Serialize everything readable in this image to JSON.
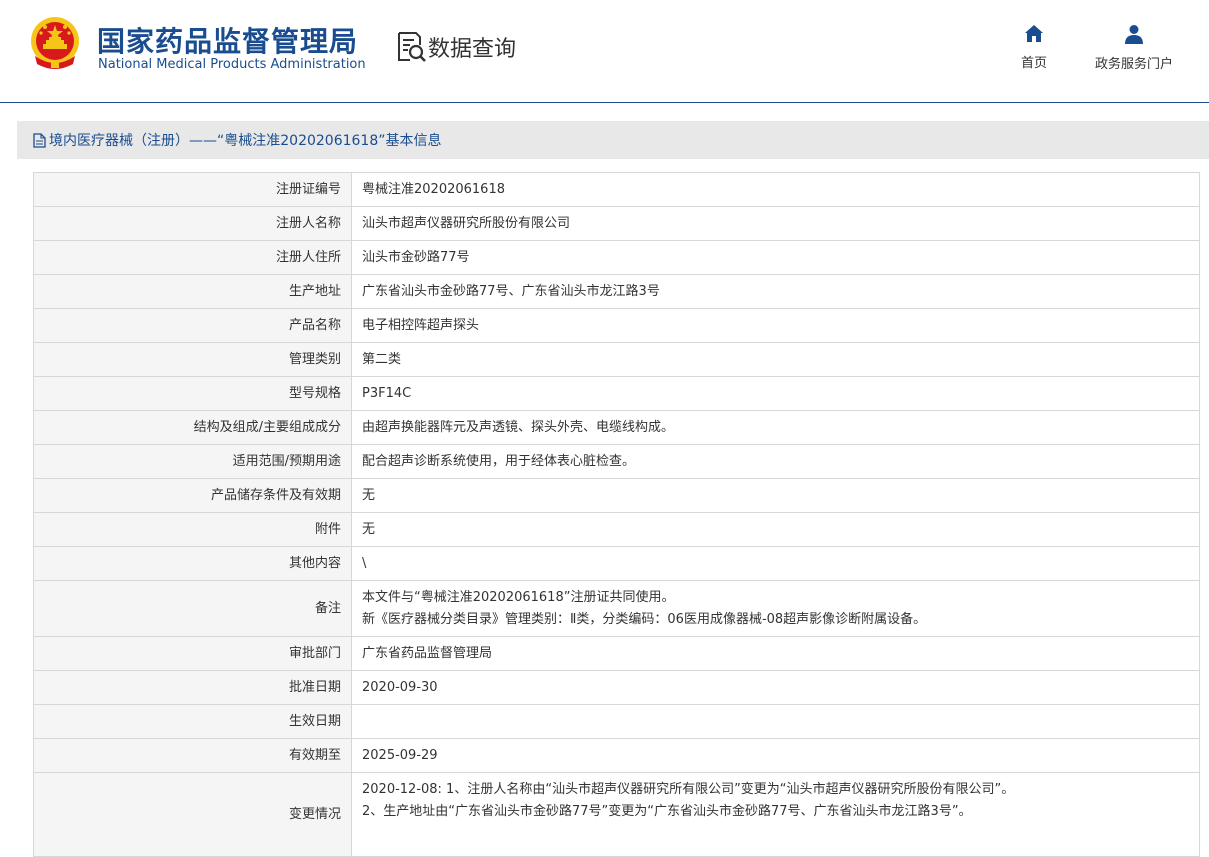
{
  "header": {
    "org_name_cn": "国家药品监督管理局",
    "org_name_en": "National Medical Products Administration",
    "query_label": "数据查询",
    "nav": [
      {
        "label": "首页",
        "icon": "home-icon"
      },
      {
        "label": "政务服务门户",
        "icon": "user-icon"
      }
    ]
  },
  "panel": {
    "title": "境内医疗器械（注册）——“粤械注准20202061618”基本信息",
    "title_icon": "document-icon"
  },
  "records": [
    {
      "label": "注册证编号",
      "value": "粤械注准20202061618"
    },
    {
      "label": "注册人名称",
      "value": "汕头市超声仪器研究所股份有限公司"
    },
    {
      "label": "注册人住所",
      "value": "汕头市金砂路77号"
    },
    {
      "label": "生产地址",
      "value": "广东省汕头市金砂路77号、广东省汕头市龙江路3号"
    },
    {
      "label": "产品名称",
      "value": "电子相控阵超声探头"
    },
    {
      "label": "管理类别",
      "value": "第二类"
    },
    {
      "label": "型号规格",
      "value": "P3F14C"
    },
    {
      "label": "结构及组成/主要组成成分",
      "value": "由超声换能器阵元及声透镜、探头外壳、电缆线构成。"
    },
    {
      "label": "适用范围/预期用途",
      "value": "配合超声诊断系统使用，用于经体表心脏检查。"
    },
    {
      "label": "产品储存条件及有效期",
      "value": "无"
    },
    {
      "label": "附件",
      "value": "无"
    },
    {
      "label": "其他内容",
      "value": "\\"
    },
    {
      "label": "备注",
      "lines": [
        "本文件与“粤械注准20202061618”注册证共同使用。",
        "新《医疗器械分类目录》管理类别：Ⅱ类，分类编码：06医用成像器械-08超声影像诊断附属设备。"
      ]
    },
    {
      "label": "审批部门",
      "value": "广东省药品监督管理局"
    },
    {
      "label": "批准日期",
      "value": "2020-09-30"
    },
    {
      "label": "生效日期",
      "value": ""
    },
    {
      "label": "有效期至",
      "value": "2025-09-29"
    },
    {
      "label": "变更情况",
      "lines": [
        "2020-12-08: 1、注册人名称由“汕头市超声仪器研究所有限公司”变更为“汕头市超声仪器研究所股份有限公司”。",
        "2、生产地址由“广东省汕头市金砂路77号”变更为“广东省汕头市金砂路77号、广东省汕头市龙江路3号”。"
      ]
    }
  ],
  "colors": {
    "brand_blue": "#1a4d8f",
    "emblem_red": "#d7191c",
    "emblem_gold": "#f5c518",
    "label_bg": "#f5f5f5",
    "title_bar_bg": "#e8e8e8"
  }
}
